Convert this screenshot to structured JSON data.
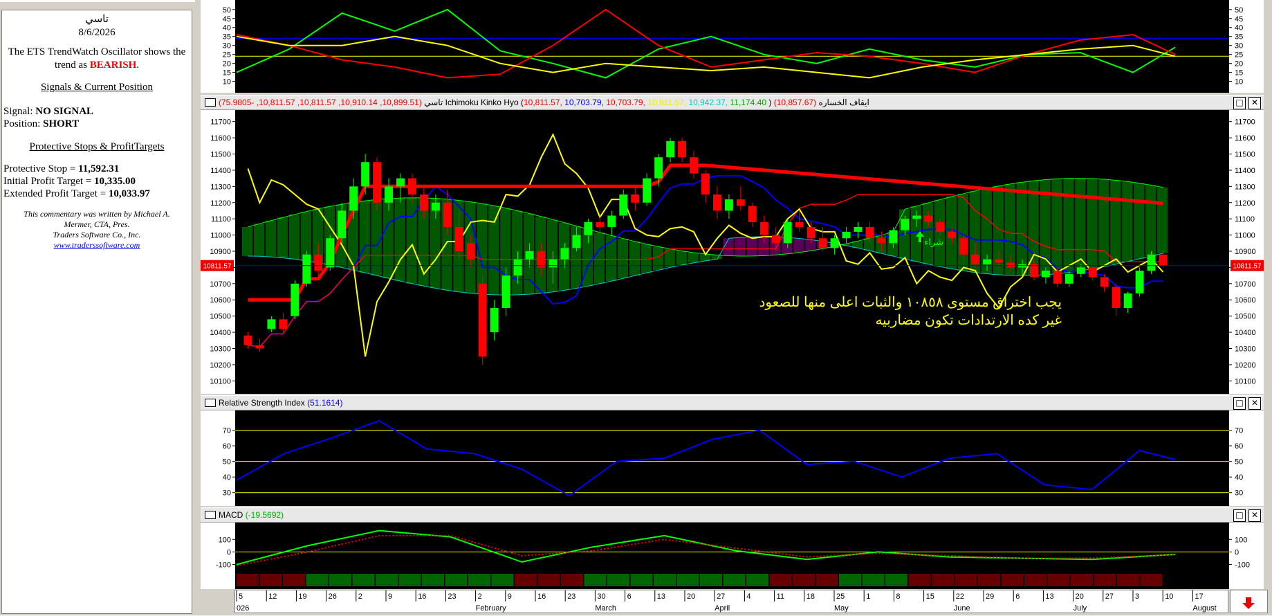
{
  "commentary": {
    "symbol": "تاسي",
    "date": "8/6/2026",
    "trend_text": "The ETS TrendWatch Oscillator shows the trend as",
    "trend_value": "BEARISH",
    "signals_heading": "Signals & Current Position",
    "signal_label": "Signal:",
    "signal_value": "NO SIGNAL",
    "position_label": "Position:",
    "position_value": "SHORT",
    "stops_heading": "Protective Stops & ProfitTargets",
    "protective_stop_label": "Protective Stop =",
    "protective_stop_value": "11,592.31",
    "initial_target_label": "Initial Profit Target =",
    "initial_target_value": "10,335.00",
    "extended_target_label": "Extended Profit Target =",
    "extended_target_value": "10,033.97",
    "credit_line1": "This commentary was written by Michael A.",
    "credit_line2": "Mermer, CTA, Pres.",
    "credit_line3": "Traders Software Co., Inc.",
    "credit_link": "www.traderssoftware.com"
  },
  "colors": {
    "price_up": "#00ff00",
    "price_down": "#ff0000",
    "stop_line": "#ff0000",
    "tenkan": "#0000ff",
    "kijun": "#ff0000",
    "chikou": "#ffff00",
    "cloud_green": "#00ff00",
    "cloud_magenta": "#ff00ff",
    "rsi_line": "#0000ff",
    "macd_line": "#00ff00",
    "macd_signal": "#ff0000"
  },
  "headers": {
    "price": {
      "name": "تاسي",
      "ohlc": "(10,899.51, 10,910.14, 10,811.57, 10,811.57, -75.9805)",
      "ichimoku_label": "Ichimoku Kinko Hyo (",
      "ich_v1": "10,811.57,",
      "ich_v2": "10,703.79,",
      "ich_v3": "10,703.79,",
      "ich_v4": "10,811.57,",
      "ich_v5": "10,942.37,",
      "ich_v6": "11,174.40",
      "ich_close": ")",
      "stop_label": "ايقاف الخساره",
      "stop_value": "(10,857.67)"
    },
    "rsi": {
      "name": "Relative Strength Index",
      "value": "(51.1614)"
    },
    "macd": {
      "name": "MACD",
      "value": "(-19.5692)"
    }
  },
  "annotations": {
    "arabic_line1": "يجب اختراق مستوى ١٠٨٥٨ والثبات اعلى منها للصعود",
    "arabic_line2": "غير كده الارتدادات تكون مضاربيه",
    "buy_label": "شراء",
    "price_tag": "10811.57",
    "window_max": "□",
    "window_close": "✕"
  },
  "chart_data": [
    {
      "type": "line",
      "panel": "oscillator",
      "yticks": [
        10,
        15,
        20,
        25,
        30,
        35,
        40,
        45,
        50
      ],
      "ylim": [
        6,
        53
      ],
      "reference_lines": [
        34,
        24
      ],
      "x": [
        0,
        5,
        10,
        15,
        20,
        25,
        30,
        35,
        40,
        45,
        50,
        55,
        60,
        65,
        70,
        75,
        80,
        85,
        89
      ],
      "series": [
        {
          "color": "#00ff00",
          "values": [
            15,
            28,
            48,
            38,
            50,
            27,
            20,
            12,
            28,
            35,
            25,
            20,
            28,
            22,
            18,
            25,
            26,
            15,
            29
          ]
        },
        {
          "color": "#ff0000",
          "values": [
            36,
            30,
            22,
            18,
            12,
            14,
            30,
            50,
            30,
            18,
            22,
            26,
            24,
            20,
            15,
            25,
            33,
            36,
            25
          ]
        },
        {
          "color": "#ffff00",
          "values": [
            35,
            30,
            30,
            35,
            30,
            20,
            15,
            20,
            18,
            16,
            18,
            15,
            12,
            18,
            22,
            25,
            28,
            30,
            24
          ]
        }
      ]
    },
    {
      "type": "candlestick",
      "panel": "price",
      "yticks": [
        10100,
        10200,
        10300,
        10400,
        10500,
        10600,
        10700,
        10800,
        10900,
        11000,
        11100,
        11200,
        11300,
        11400,
        11500,
        11600,
        11700
      ],
      "ylim": [
        10080,
        11720
      ],
      "last_price": 10811.57,
      "current_line": 10858,
      "ohlc": [
        [
          10380,
          10400,
          10300,
          10320
        ],
        [
          10320,
          10360,
          10280,
          10300
        ],
        [
          10420,
          10500,
          10400,
          10480
        ],
        [
          10480,
          10520,
          10400,
          10420
        ],
        [
          10500,
          10720,
          10480,
          10700
        ],
        [
          10700,
          10900,
          10680,
          10880
        ],
        [
          10880,
          10950,
          10750,
          10780
        ],
        [
          10800,
          11000,
          10780,
          10980
        ],
        [
          10980,
          11200,
          10950,
          11150
        ],
        [
          11150,
          11350,
          11100,
          11300
        ],
        [
          11300,
          11500,
          11250,
          11450
        ],
        [
          11450,
          11480,
          11150,
          11200
        ],
        [
          11200,
          11350,
          11150,
          11300
        ],
        [
          11300,
          11380,
          11200,
          11350
        ],
        [
          11350,
          11380,
          11200,
          11250
        ],
        [
          11250,
          11300,
          11100,
          11150
        ],
        [
          11150,
          11250,
          11100,
          11200
        ],
        [
          11200,
          11280,
          11000,
          11050
        ],
        [
          11050,
          11150,
          10850,
          10900
        ],
        [
          10950,
          11000,
          10800,
          10850
        ],
        [
          10700,
          10750,
          10200,
          10250
        ],
        [
          10400,
          10600,
          10350,
          10550
        ],
        [
          10550,
          10800,
          10500,
          10750
        ],
        [
          10750,
          10900,
          10700,
          10850
        ],
        [
          10850,
          10950,
          10800,
          10900
        ],
        [
          10900,
          10950,
          10750,
          10800
        ],
        [
          10800,
          10900,
          10700,
          10850
        ],
        [
          10850,
          10950,
          10800,
          10920
        ],
        [
          10920,
          11050,
          10900,
          11000
        ],
        [
          11000,
          11100,
          10950,
          11080
        ],
        [
          11080,
          11150,
          11000,
          11050
        ],
        [
          11050,
          11150,
          11000,
          11120
        ],
        [
          11120,
          11280,
          11100,
          11250
        ],
        [
          11250,
          11300,
          11150,
          11200
        ],
        [
          11200,
          11380,
          11180,
          11350
        ],
        [
          11350,
          11500,
          11300,
          11480
        ],
        [
          11480,
          11600,
          11450,
          11580
        ],
        [
          11580,
          11600,
          11450,
          11480
        ],
        [
          11480,
          11520,
          11350,
          11380
        ],
        [
          11380,
          11400,
          11200,
          11250
        ],
        [
          11250,
          11300,
          11100,
          11150
        ],
        [
          11150,
          11250,
          11100,
          11220
        ],
        [
          11220,
          11300,
          11150,
          11180
        ],
        [
          11180,
          11200,
          11050,
          11080
        ],
        [
          11080,
          11120,
          10950,
          11000
        ],
        [
          11000,
          11050,
          10900,
          10950
        ],
        [
          10950,
          11100,
          10920,
          11080
        ],
        [
          11080,
          11150,
          11020,
          11050
        ],
        [
          11050,
          11080,
          10950,
          10980
        ],
        [
          10980,
          11050,
          10900,
          10920
        ],
        [
          10920,
          11000,
          10880,
          10980
        ],
        [
          10980,
          11050,
          10950,
          11020
        ],
        [
          11020,
          11080,
          10980,
          11050
        ],
        [
          11050,
          11080,
          10950,
          10980
        ],
        [
          10980,
          11020,
          10900,
          10950
        ],
        [
          10950,
          11050,
          10920,
          11030
        ],
        [
          11030,
          11120,
          11000,
          11100
        ],
        [
          11100,
          11150,
          11050,
          11120
        ],
        [
          11120,
          11150,
          11050,
          11080
        ],
        [
          11080,
          11100,
          11000,
          11020
        ],
        [
          11020,
          11050,
          10950,
          10980
        ],
        [
          10980,
          11000,
          10850,
          10880
        ],
        [
          10880,
          10950,
          10800,
          10820
        ],
        [
          10820,
          10880,
          10780,
          10850
        ],
        [
          10850,
          10900,
          10800,
          10830
        ],
        [
          10830,
          10880,
          10780,
          10800
        ],
        [
          10800,
          10850,
          10750,
          10820
        ],
        [
          10820,
          10850,
          10720,
          10740
        ],
        [
          10740,
          10800,
          10700,
          10780
        ],
        [
          10780,
          10800,
          10680,
          10700
        ],
        [
          10700,
          10780,
          10680,
          10760
        ],
        [
          10760,
          10820,
          10740,
          10800
        ],
        [
          10800,
          10820,
          10720,
          10740
        ],
        [
          10740,
          10760,
          10650,
          10680
        ],
        [
          10680,
          10700,
          10500,
          10550
        ],
        [
          10550,
          10650,
          10520,
          10640
        ],
        [
          10640,
          10800,
          10620,
          10780
        ],
        [
          10780,
          10900,
          10760,
          10880
        ],
        [
          10880,
          10910,
          10800,
          10812
        ]
      ]
    },
    {
      "type": "line",
      "panel": "rsi",
      "yticks": [
        30,
        40,
        50,
        60,
        70
      ],
      "ylim": [
        25,
        80
      ],
      "reference_lines": [
        70,
        50,
        30
      ],
      "x": [
        0,
        4,
        8,
        12,
        16,
        20,
        24,
        28,
        32,
        36,
        40,
        44,
        48,
        52,
        56,
        60,
        64,
        68,
        72,
        76,
        79
      ],
      "values": [
        38,
        55,
        65,
        76,
        58,
        55,
        45,
        28,
        50,
        52,
        64,
        70,
        48,
        50,
        40,
        52,
        55,
        35,
        32,
        57,
        51.16
      ]
    },
    {
      "type": "line",
      "panel": "macd",
      "yticks": [
        -100,
        0,
        100
      ],
      "ylim": [
        -130,
        190
      ],
      "reference_lines": [
        0
      ],
      "x": [
        0,
        6,
        12,
        18,
        24,
        30,
        36,
        42,
        48,
        54,
        60,
        66,
        72,
        79
      ],
      "series": [
        {
          "color": "#00ff00",
          "values": [
            -100,
            50,
            170,
            120,
            -80,
            40,
            130,
            10,
            -60,
            0,
            -40,
            -50,
            -60,
            -19.57
          ]
        },
        {
          "color": "#ff0000",
          "style": "dotted",
          "values": [
            -110,
            0,
            130,
            130,
            -30,
            10,
            100,
            30,
            -40,
            -10,
            -30,
            -50,
            -50,
            -20
          ]
        }
      ]
    }
  ],
  "xaxis": {
    "labels": [
      "5",
      "12",
      "19",
      "26",
      "2",
      "9",
      "16",
      "23",
      "2",
      "9",
      "16",
      "23",
      "30",
      "6",
      "13",
      "20",
      "27",
      "4",
      "11",
      "18",
      "25",
      "1",
      "8",
      "15",
      "22",
      "29",
      "6",
      "13",
      "20",
      "27",
      "3",
      "10",
      "17"
    ],
    "months": [
      "026",
      "February",
      "March",
      "April",
      "May",
      "June",
      "July",
      "August"
    ]
  }
}
